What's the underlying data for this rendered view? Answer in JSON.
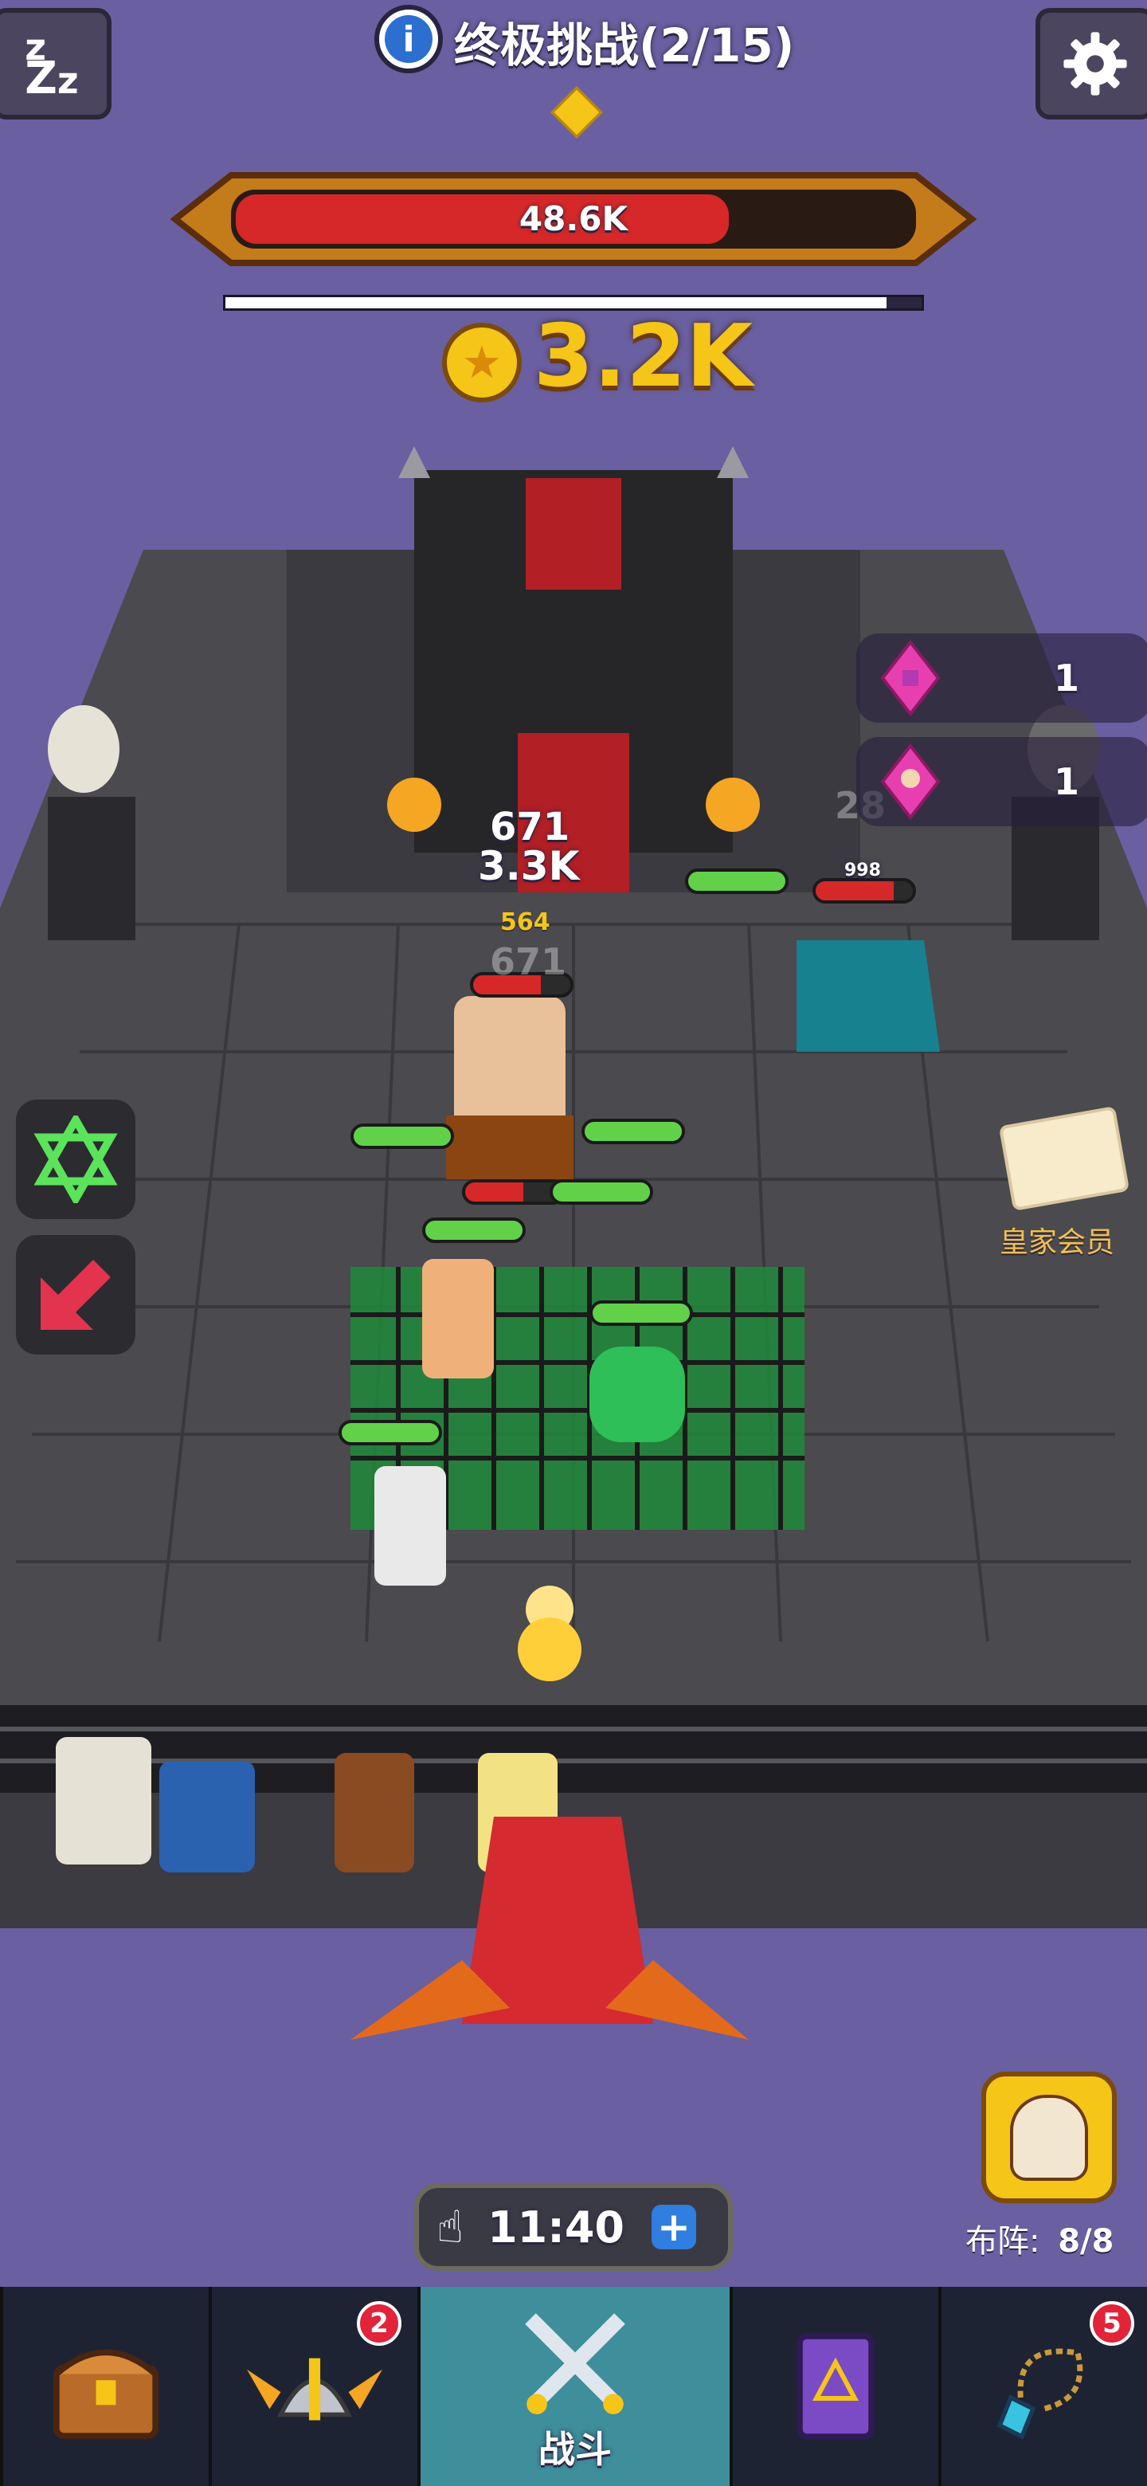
{
  "header": {
    "title": "终极挑战(2/15)",
    "sleep_icon": "zzz-icon",
    "settings_icon": "gear-icon",
    "info_icon": "info-icon"
  },
  "boss": {
    "hp_text": "48.6K",
    "hp_fraction": 0.73,
    "progress_fraction": 0.95
  },
  "coins": {
    "value": "3.2K",
    "icon": "coin-icon"
  },
  "side_rewards": [
    {
      "icon": "pink-gem-icon",
      "count": "1"
    },
    {
      "icon": "pink-gem-portrait-icon",
      "count": "1"
    }
  ],
  "left_buttons": [
    {
      "icon": "hexagram-icon"
    },
    {
      "icon": "red-arrow-icon"
    }
  ],
  "royal": {
    "label": "皇家会员",
    "icon": "royal-card-icon"
  },
  "damage_numbers": [
    "671",
    "3.3K",
    "564",
    "671",
    "28",
    "998"
  ],
  "timer": {
    "value": "11:40",
    "icon": "tap-hand-icon",
    "plus_icon": "plus-icon"
  },
  "formation": {
    "label": "布阵:",
    "value": "8/8",
    "icon": "hero-portrait-icon"
  },
  "dock": {
    "tabs": [
      {
        "icon": "treasure-chest-icon",
        "label": "",
        "badge": ""
      },
      {
        "icon": "winged-helmet-icon",
        "label": "",
        "badge": "2"
      },
      {
        "icon": "crossed-swords-icon",
        "label": "战斗",
        "badge": ""
      },
      {
        "icon": "spellbook-icon",
        "label": "",
        "badge": ""
      },
      {
        "icon": "amulet-icon",
        "label": "",
        "badge": "5"
      }
    ]
  },
  "colors": {
    "background": "#6a5fa0",
    "boss_hp": "#d62828",
    "coin": "#f5c518",
    "active_tab": "#3e8e9c"
  }
}
